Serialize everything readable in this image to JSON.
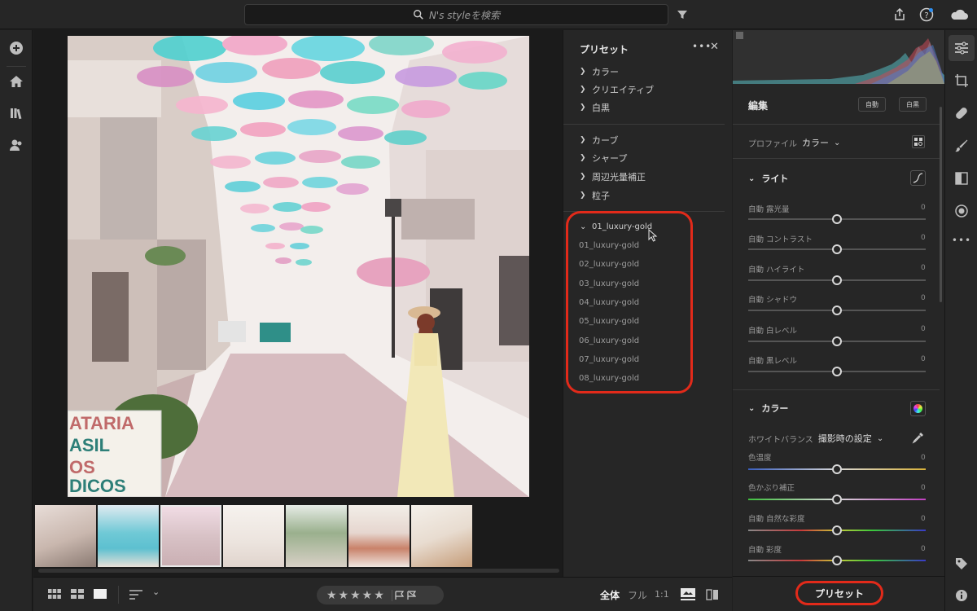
{
  "search": {
    "placeholder": "N's styleを検索"
  },
  "presets_panel": {
    "title": "プリセット",
    "groups_a": [
      "カラー",
      "クリエイティブ",
      "白黒"
    ],
    "groups_b": [
      "カーブ",
      "シャープ",
      "周辺光量補正",
      "粒子"
    ],
    "expanded_group": "01_luxury-gold",
    "preset_items": [
      "01_luxury-gold",
      "02_luxury-gold",
      "03_luxury-gold",
      "04_luxury-gold",
      "05_luxury-gold",
      "06_luxury-gold",
      "07_luxury-gold",
      "08_luxury-gold"
    ]
  },
  "photo": {
    "sign_text": [
      "ATARIA",
      "ASIL",
      "OS",
      "DICOS"
    ]
  },
  "edit_panel": {
    "title": "編集",
    "auto_button": "自動",
    "bw_button": "白黒",
    "profile_label": "プロファイル",
    "profile_value": "カラー",
    "light_section": "ライト",
    "light_sliders": [
      {
        "label": "自動 露光量",
        "value": "0"
      },
      {
        "label": "自動 コントラスト",
        "value": "0"
      },
      {
        "label": "自動 ハイライト",
        "value": "0"
      },
      {
        "label": "自動 シャドウ",
        "value": "0"
      },
      {
        "label": "自動 白レベル",
        "value": "0"
      },
      {
        "label": "自動 黒レベル",
        "value": "0"
      }
    ],
    "color_section": "カラー",
    "wb_label": "ホワイトバランス",
    "wb_value": "撮影時の設定",
    "color_sliders": [
      {
        "label": "色温度",
        "value": "0"
      },
      {
        "label": "色かぶり補正",
        "value": "0"
      },
      {
        "label": "自動 自然な彩度",
        "value": "0"
      },
      {
        "label": "自動 彩度",
        "value": "0"
      }
    ],
    "preset_button": "プリセット"
  },
  "bottom_bar": {
    "stars": "★★★★★",
    "view_all": "全体",
    "view_full": "フル",
    "view_1to1": "1:1"
  },
  "colors": {
    "accent_red": "#e22a1a",
    "panel_bg": "#262626"
  }
}
